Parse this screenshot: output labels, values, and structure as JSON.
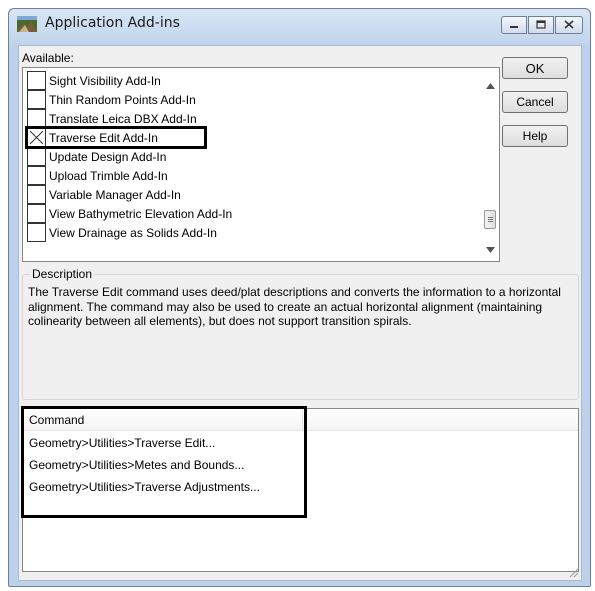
{
  "window": {
    "title": "Application Add-ins",
    "icon": "app-addins-icon",
    "controls": [
      "minimize-icon",
      "maximize-icon",
      "close-icon"
    ]
  },
  "available": {
    "label": "Available:",
    "items": [
      {
        "label": "Sight Visibility Add-In",
        "checked": false
      },
      {
        "label": "Thin Random Points Add-In",
        "checked": false
      },
      {
        "label": "Translate Leica DBX Add-In",
        "checked": false
      },
      {
        "label": "Traverse Edit Add-In",
        "checked": true
      },
      {
        "label": "Update Design Add-In",
        "checked": false
      },
      {
        "label": "Upload Trimble Add-In",
        "checked": false
      },
      {
        "label": "Variable Manager Add-In",
        "checked": false
      },
      {
        "label": "View Bathymetric Elevation Add-In",
        "checked": false
      },
      {
        "label": "View Drainage as Solids Add-In",
        "checked": false
      }
    ]
  },
  "buttons": {
    "ok": "OK",
    "cancel": "Cancel",
    "help": "Help"
  },
  "description": {
    "legend": "Description",
    "text": "The Traverse Edit command uses deed/plat descriptions and converts the information to a horizontal alignment. The command may also be used to create an actual horizontal alignment (maintaining colinearity between all elements), but does not support transition spirals."
  },
  "commands": {
    "header": "Command",
    "rows": [
      "Geometry>Utilities>Traverse Edit...",
      "Geometry>Utilities>Metes and Bounds...",
      "Geometry>Utilities>Traverse Adjustments..."
    ]
  },
  "colors": {
    "frame": "#bcd1ea",
    "client": "#f0f0f0",
    "highlight": "#000000"
  }
}
